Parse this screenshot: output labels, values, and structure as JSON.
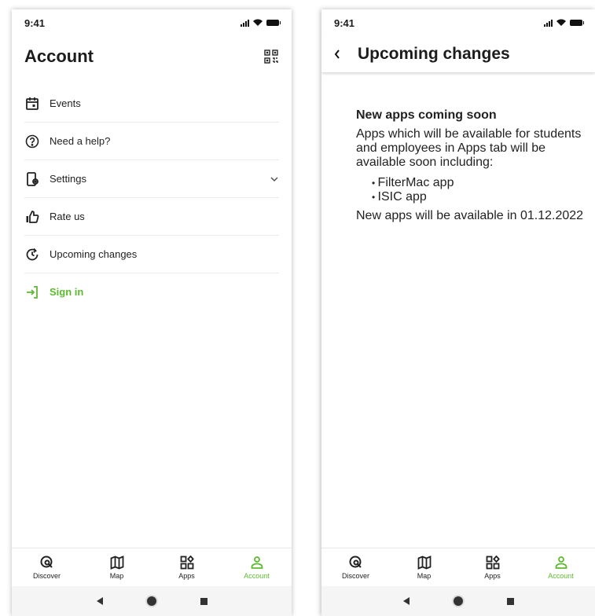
{
  "status": {
    "time": "9:41"
  },
  "account": {
    "title": "Account",
    "menu": [
      {
        "label": "Events",
        "icon": "calendar-icon"
      },
      {
        "label": "Need a help?",
        "icon": "help-icon"
      },
      {
        "label": "Settings",
        "icon": "settings-device-icon"
      },
      {
        "label": "Rate us",
        "icon": "thumbs-up-icon"
      },
      {
        "label": "Upcoming changes",
        "icon": "update-icon"
      }
    ],
    "signin": {
      "label": "Sign in",
      "icon": "sign-in-icon"
    }
  },
  "tabs": [
    {
      "label": "Discover",
      "icon": "discover-icon"
    },
    {
      "label": "Map",
      "icon": "map-icon"
    },
    {
      "label": "Apps",
      "icon": "apps-icon"
    },
    {
      "label": "Account",
      "icon": "account-icon",
      "active": true
    }
  ],
  "detail": {
    "title": "Upcoming changes",
    "heading": "New apps coming soon",
    "intro": "Apps which will be available for students and employees in Apps tab will be available soon including:",
    "apps": [
      "FilterMac app",
      "ISIC app"
    ],
    "outro": "New apps will be available in 01.12.2022"
  },
  "colors": {
    "accent": "#5cba2f",
    "text": "#1c1c1c"
  }
}
